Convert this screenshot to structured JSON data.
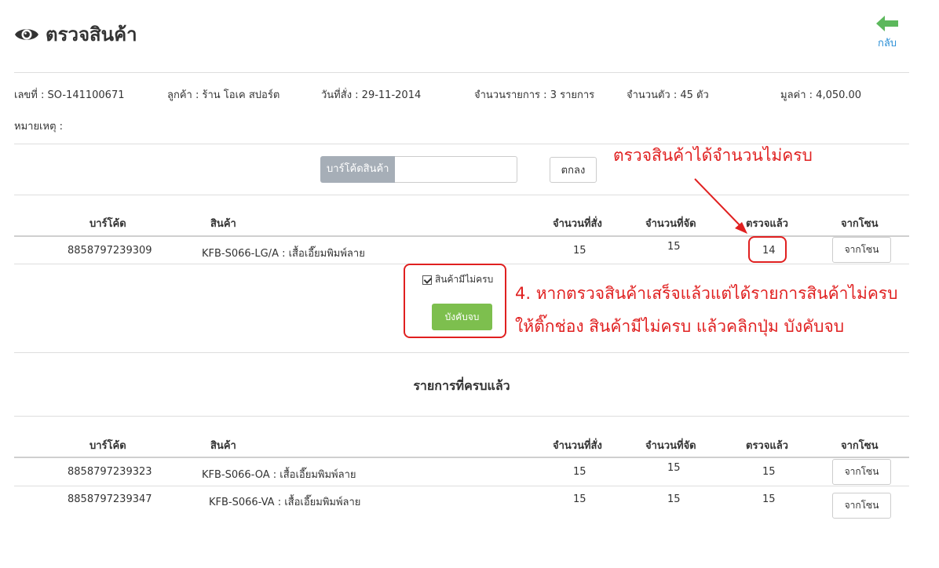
{
  "page": {
    "title": "ตรวจสินค้า",
    "back_label": "กลับ"
  },
  "order": {
    "number": "เลขที่ : SO-141100671",
    "customer": "ลูกค้า : ร้าน โอเค สปอร์ต",
    "date": "วันที่สั่ง : 29-11-2014",
    "item_count": "จำนวนรายการ : 3 รายการ",
    "qty": "จำนวนตัว : 45 ตัว",
    "value": "มูลค่า : 4,050.00",
    "note": "หมายเหตุ :"
  },
  "search": {
    "addon": "บาร์โค้ดสินค้า",
    "value": "",
    "ok_label": "ตกลง"
  },
  "columns": [
    "บาร์โค้ด",
    "สินค้า",
    "จำนวนที่สั่ง",
    "จำนวนที่จัด",
    "ตรวจแล้ว",
    "จากโซน"
  ],
  "pending": [
    {
      "barcode": "8858797239309",
      "product": "KFB-S066-LG/A : เสื้อเอี๊ยมพิมพ์ลาย",
      "ordered": "15",
      "picked": "15",
      "checked": "14",
      "zone_label": "จากโซน"
    }
  ],
  "incomplete": {
    "checkbox_label": "สินค้ามีไม่ครบ",
    "checked": true,
    "force_label": "บังคับจบ"
  },
  "completed": {
    "title": "รายการที่ครบแล้ว",
    "rows": [
      {
        "barcode": "8858797239323",
        "product": "KFB-S066-OA : เสื้อเอี๊ยมพิมพ์ลาย",
        "ordered": "15",
        "picked": "15",
        "checked": "15",
        "zone_label": "จากโซน"
      },
      {
        "barcode": "8858797239347",
        "product": "KFB-S066-VA : เสื้อเอี๊ยมพิมพ์ลาย",
        "ordered": "15",
        "picked": "15",
        "checked": "15",
        "zone_label": "จากโซน"
      }
    ]
  },
  "annotations": {
    "top": "ตรวจสินค้าได้จำนวนไม่ครบ",
    "line1": "4. หากตรวจสินค้าเสร็จแล้วแต่ได้รายการสินค้าไม่ครบ",
    "line2": "ให้ติ๊กช่อง สินค้ามีไม่ครบ แล้วคลิกปุ่ม บังคับจบ"
  },
  "colors": {
    "accent_green": "#7dbf4e",
    "annotation_red": "#e02020",
    "link_blue": "#2b8fd6"
  }
}
